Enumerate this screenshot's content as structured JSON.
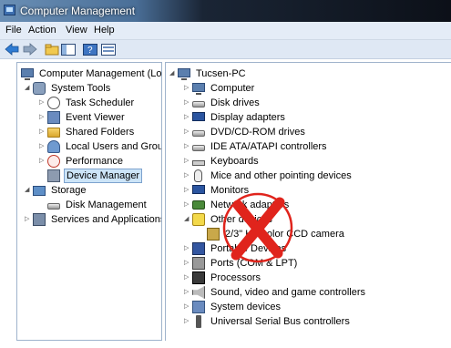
{
  "window": {
    "title": "Computer Management"
  },
  "menu": [
    "File",
    "Action",
    "View",
    "Help"
  ],
  "toolbar": {
    "buttons": [
      "back-arrow-icon",
      "forward-arrow-icon",
      "up-folder-icon",
      "show-hide-tree-icon",
      "help-icon",
      "properties-icon"
    ]
  },
  "tree": {
    "root": "Computer Management (Local",
    "system_tools": "System Tools",
    "task_scheduler": "Task Scheduler",
    "event_viewer": "Event Viewer",
    "shared_folders": "Shared Folders",
    "local_users": "Local Users and Groups",
    "performance": "Performance",
    "device_manager": "Device Manager",
    "storage": "Storage",
    "disk_management": "Disk Management",
    "services": "Services and Applications"
  },
  "devices": {
    "host": "Tucsen-PC",
    "items": [
      "Computer",
      "Disk drives",
      "Display adapters",
      "DVD/CD-ROM drives",
      "IDE ATA/ATAPI controllers",
      "Keyboards",
      "Mice and other pointing devices",
      "Monitors",
      "Network adapters",
      "Other devices",
      "2/3\" HP color CCD camera",
      "Portable Devices",
      "Ports (COM & LPT)",
      "Processors",
      "Sound, video and game controllers",
      "System devices",
      "Universal Serial Bus controllers"
    ]
  },
  "annotation": {
    "mark": "red-x-circle",
    "color": "#e0241c"
  }
}
